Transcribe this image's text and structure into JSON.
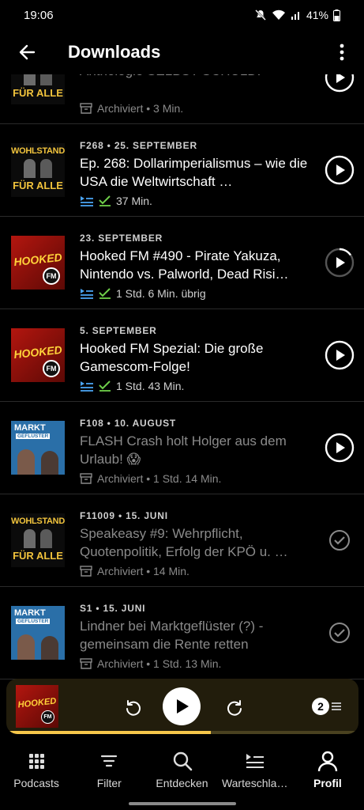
{
  "status_bar": {
    "time": "19:06",
    "battery": "41%"
  },
  "header": {
    "title": "Downloads"
  },
  "episodes": [
    {
      "show": "wohlstand",
      "meta": "",
      "title": "Anthologie SELBST SCHULD!",
      "status": "Archiviert • 3 Min.",
      "state": "archived",
      "action": "play"
    },
    {
      "show": "wohlstand",
      "meta": "F268 • 25. SEPTEMBER",
      "title": "Ep. 268: Dollarimperialismus – wie die USA die Weltwirtschaft …",
      "status": "37 Min.",
      "state": "downloaded",
      "action": "play"
    },
    {
      "show": "hooked",
      "meta": "23. SEPTEMBER",
      "title": "Hooked FM #490 - Pirate Yakuza, Nintendo vs. Palworld, Dead Risi…",
      "status": "1 Std. 6 Min. übrig",
      "state": "downloaded",
      "action": "partial"
    },
    {
      "show": "hooked",
      "meta": "5. SEPTEMBER",
      "title": "Hooked FM Spezial: Die große Gamescom-Folge!",
      "status": "1 Std. 43 Min.",
      "state": "downloaded",
      "action": "play"
    },
    {
      "show": "markt",
      "meta": "F108 • 10. AUGUST",
      "title": "FLASH Crash holt Holger aus dem Urlaub! 😱",
      "status": "Archiviert • 1 Std. 14 Min.",
      "state": "archived",
      "action": "play"
    },
    {
      "show": "wohlstand",
      "meta": "F11009 • 15. JUNI",
      "title": "Speakeasy #9: Wehrpflicht, Quotenpolitik, Erfolg der KPÖ u. …",
      "status": "Archiviert • 14 Min.",
      "state": "archived",
      "action": "played"
    },
    {
      "show": "markt",
      "meta": "S1 • 15. JUNI",
      "title": "Lindner bei Marktgeflüster (?) - gemeinsam die Rente retten",
      "status": "Archiviert • 1 Std. 13 Min.",
      "state": "archived",
      "action": "played"
    }
  ],
  "shows": {
    "wohlstand": {
      "line1": "WOHLSTAND",
      "line2": "FÜR ALLE"
    },
    "hooked": {
      "line1": "HOOKED",
      "badge": "FM"
    },
    "markt": {
      "line1": "MARKT",
      "line2": "GEFLÜSTER"
    }
  },
  "mini_player": {
    "show": "hooked",
    "queue_count": "2",
    "progress": 0.58
  },
  "nav": [
    {
      "label": "Podcasts",
      "icon": "grid-icon"
    },
    {
      "label": "Filter",
      "icon": "filter-icon"
    },
    {
      "label": "Entdecken",
      "icon": "search-icon"
    },
    {
      "label": "Warteschla…",
      "icon": "queue-icon"
    },
    {
      "label": "Profil",
      "icon": "profile-icon",
      "active": true
    }
  ],
  "colors": {
    "accent": "#f6c74a",
    "queue_blue": "#4aa3f0",
    "check_green": "#6fcf4a"
  }
}
